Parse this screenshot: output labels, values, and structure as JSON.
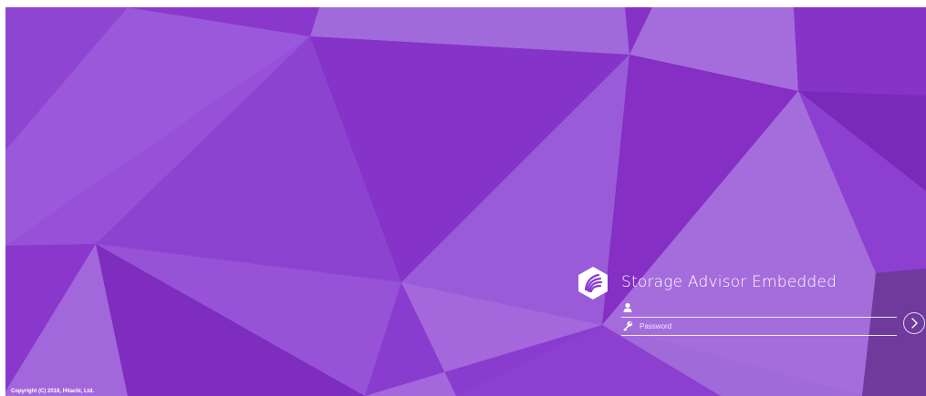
{
  "app": {
    "title": "Storage Advisor Embedded",
    "logo_icon": "hitachi-hexagon-logo-icon"
  },
  "login": {
    "username": {
      "icon": "user-icon",
      "value": "",
      "placeholder": ""
    },
    "password": {
      "icon": "key-icon",
      "value": "",
      "placeholder": "Password"
    },
    "submit_icon": "chevron-right-circle-icon"
  },
  "footer": {
    "copyright": "Copyright (C) 2018, Hitachi, Ltd."
  },
  "colors": {
    "purple_dark": "#7a2ab8",
    "purple_mid": "#8d3fd0",
    "purple_light": "#a56dd8",
    "purple_gray": "#6f3a9c",
    "text": "#ffffff"
  }
}
